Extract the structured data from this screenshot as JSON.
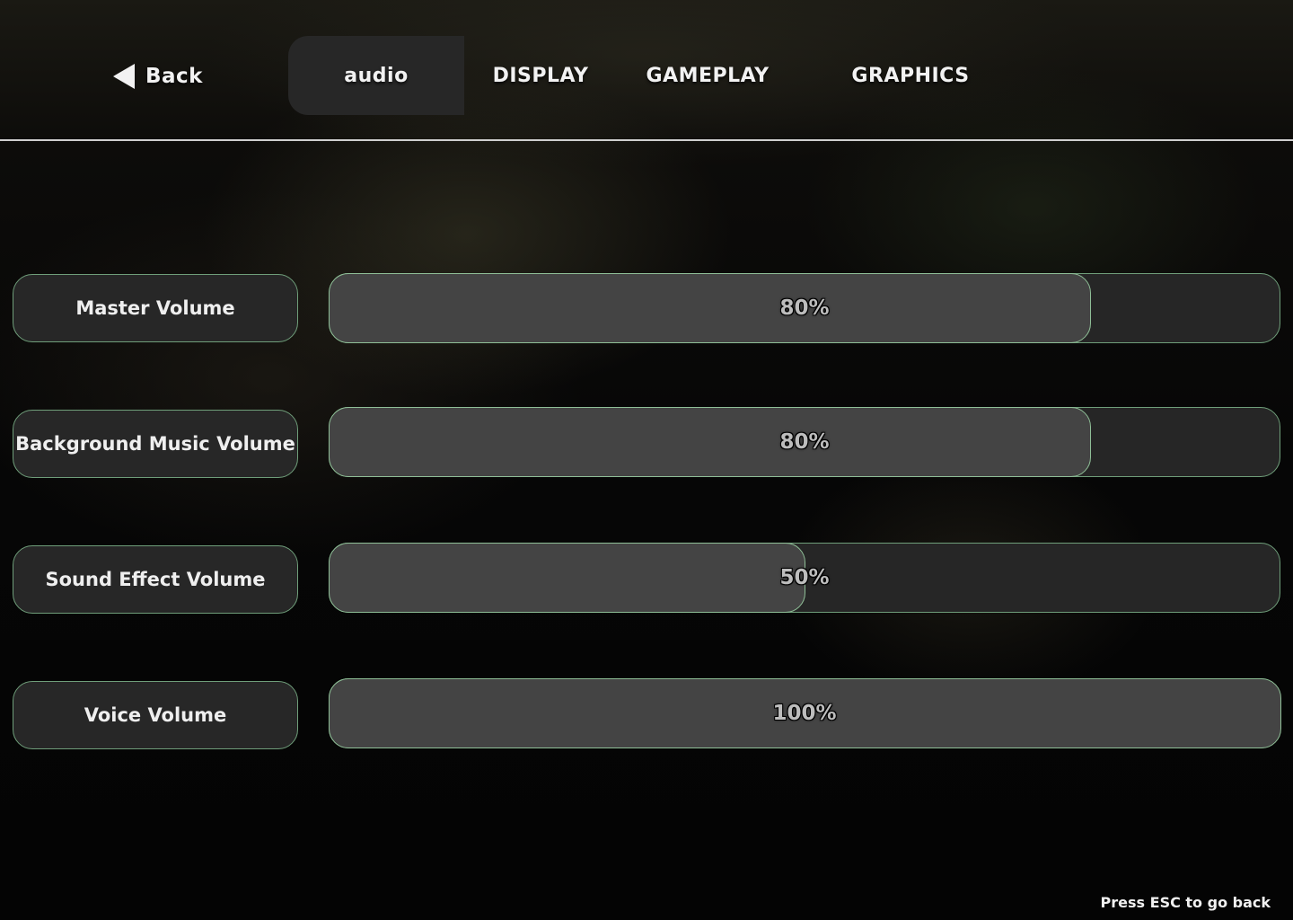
{
  "nav": {
    "back_label": "Back",
    "tabs": [
      {
        "label": "audio",
        "active": true
      },
      {
        "label": "DISPLAY",
        "active": false
      },
      {
        "label": "GAMEPLAY",
        "active": false
      },
      {
        "label": "GRAPHICS",
        "active": false
      }
    ]
  },
  "settings": [
    {
      "label": "Master Volume",
      "value": 80,
      "value_text": "80%"
    },
    {
      "label": "Background Music Volume",
      "value": 80,
      "value_text": "80%"
    },
    {
      "label": "Sound Effect Volume",
      "value": 50,
      "value_text": "50%"
    },
    {
      "label": "Voice Volume",
      "value": 100,
      "value_text": "100%"
    }
  ],
  "footer": {
    "hint": "Press ESC to go back"
  },
  "colors": {
    "accent_border": "#6f9e7a",
    "panel_bg": "#272727",
    "fill_bg": "#444444"
  }
}
